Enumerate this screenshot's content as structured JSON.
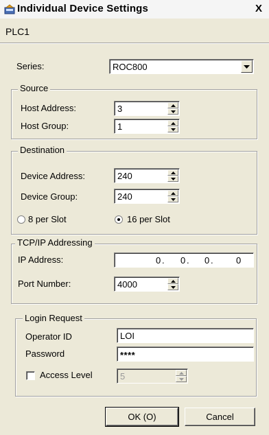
{
  "window": {
    "title": "Individual Device Settings",
    "close_glyph": "X",
    "device_name": "PLC1"
  },
  "series": {
    "label": "Series:",
    "selected": "ROC800"
  },
  "source": {
    "legend": "Source",
    "host_address_label": "Host Address:",
    "host_address": "3",
    "host_group_label": "Host Group:",
    "host_group": "1"
  },
  "destination": {
    "legend": "Destination",
    "device_address_label": "Device Address:",
    "device_address": "240",
    "device_group_label": "Device Group:",
    "device_group": "240",
    "slot_8_label": "8 per Slot",
    "slot_16_label": "16 per Slot",
    "selected_slot": "16 per Slot"
  },
  "tcpip": {
    "legend": "TCP/IP Addressing",
    "ip_label": "IP Address:",
    "ip_octets": [
      "0",
      "0",
      "0",
      "0"
    ],
    "port_label": "Port Number:",
    "port": "4000"
  },
  "login": {
    "legend": "Login Request",
    "operator_label": "Operator ID",
    "operator_id": "LOI",
    "password_label": "Password",
    "password_masked": "****",
    "access_level_label": "Access Level",
    "access_level_checked": false,
    "access_level": "5"
  },
  "buttons": {
    "ok": "OK (O)",
    "cancel": "Cancel"
  },
  "icons": {
    "title_icon": "device-settings-icon",
    "spinner": "spin-arrows-icon",
    "dropdown": "chevron-down-icon"
  }
}
